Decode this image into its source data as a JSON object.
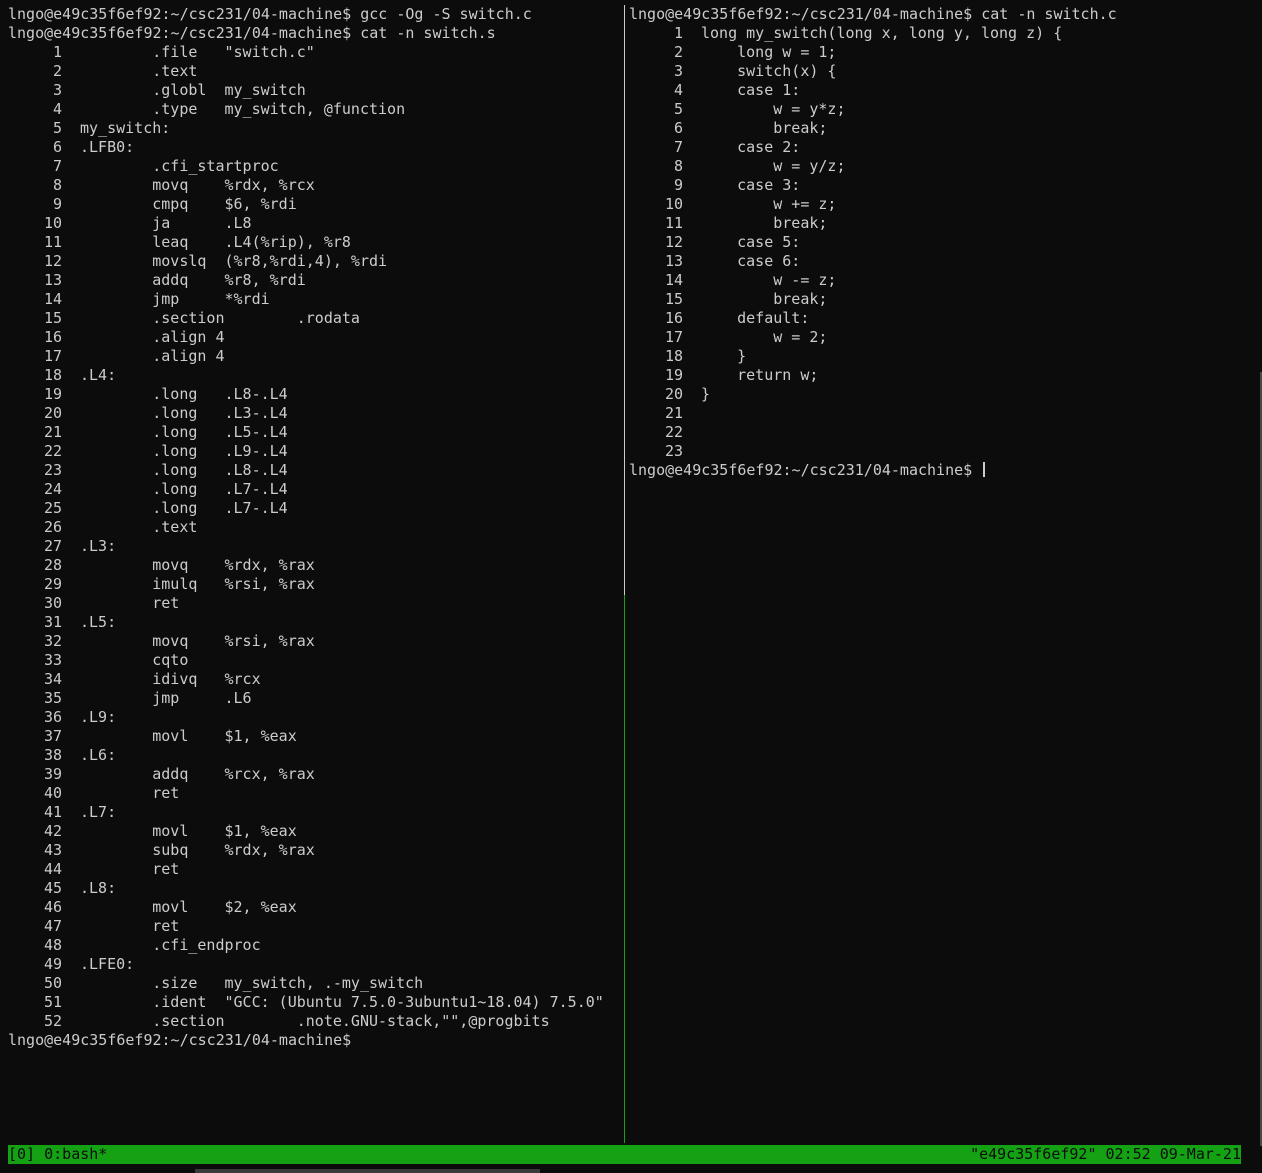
{
  "left_pane": {
    "commands": [
      "lngo@e49c35f6ef92:~/csc231/04-machine$ gcc -Og -S switch.c",
      "lngo@e49c35f6ef92:~/csc231/04-machine$ cat -n switch.s"
    ],
    "lines": [
      {
        "n": "1",
        "t": "        .file   \"switch.c\""
      },
      {
        "n": "2",
        "t": "        .text"
      },
      {
        "n": "3",
        "t": "        .globl  my_switch"
      },
      {
        "n": "4",
        "t": "        .type   my_switch, @function"
      },
      {
        "n": "5",
        "t": "my_switch:"
      },
      {
        "n": "6",
        "t": ".LFB0:"
      },
      {
        "n": "7",
        "t": "        .cfi_startproc"
      },
      {
        "n": "8",
        "t": "        movq    %rdx, %rcx"
      },
      {
        "n": "9",
        "t": "        cmpq    $6, %rdi"
      },
      {
        "n": "10",
        "t": "        ja      .L8"
      },
      {
        "n": "11",
        "t": "        leaq    .L4(%rip), %r8"
      },
      {
        "n": "12",
        "t": "        movslq  (%r8,%rdi,4), %rdi"
      },
      {
        "n": "13",
        "t": "        addq    %r8, %rdi"
      },
      {
        "n": "14",
        "t": "        jmp     *%rdi"
      },
      {
        "n": "15",
        "t": "        .section        .rodata"
      },
      {
        "n": "16",
        "t": "        .align 4"
      },
      {
        "n": "17",
        "t": "        .align 4"
      },
      {
        "n": "18",
        "t": ".L4:"
      },
      {
        "n": "19",
        "t": "        .long   .L8-.L4"
      },
      {
        "n": "20",
        "t": "        .long   .L3-.L4"
      },
      {
        "n": "21",
        "t": "        .long   .L5-.L4"
      },
      {
        "n": "22",
        "t": "        .long   .L9-.L4"
      },
      {
        "n": "23",
        "t": "        .long   .L8-.L4"
      },
      {
        "n": "24",
        "t": "        .long   .L7-.L4"
      },
      {
        "n": "25",
        "t": "        .long   .L7-.L4"
      },
      {
        "n": "26",
        "t": "        .text"
      },
      {
        "n": "27",
        "t": ".L3:"
      },
      {
        "n": "28",
        "t": "        movq    %rdx, %rax"
      },
      {
        "n": "29",
        "t": "        imulq   %rsi, %rax"
      },
      {
        "n": "30",
        "t": "        ret"
      },
      {
        "n": "31",
        "t": ".L5:"
      },
      {
        "n": "32",
        "t": "        movq    %rsi, %rax"
      },
      {
        "n": "33",
        "t": "        cqto"
      },
      {
        "n": "34",
        "t": "        idivq   %rcx"
      },
      {
        "n": "35",
        "t": "        jmp     .L6"
      },
      {
        "n": "36",
        "t": ".L9:"
      },
      {
        "n": "37",
        "t": "        movl    $1, %eax"
      },
      {
        "n": "38",
        "t": ".L6:"
      },
      {
        "n": "39",
        "t": "        addq    %rcx, %rax"
      },
      {
        "n": "40",
        "t": "        ret"
      },
      {
        "n": "41",
        "t": ".L7:"
      },
      {
        "n": "42",
        "t": "        movl    $1, %eax"
      },
      {
        "n": "43",
        "t": "        subq    %rdx, %rax"
      },
      {
        "n": "44",
        "t": "        ret"
      },
      {
        "n": "45",
        "t": ".L8:"
      },
      {
        "n": "46",
        "t": "        movl    $2, %eax"
      },
      {
        "n": "47",
        "t": "        ret"
      },
      {
        "n": "48",
        "t": "        .cfi_endproc"
      },
      {
        "n": "49",
        "t": ".LFE0:"
      },
      {
        "n": "50",
        "t": "        .size   my_switch, .-my_switch"
      },
      {
        "n": "51",
        "t": "        .ident  \"GCC: (Ubuntu 7.5.0-3ubuntu1~18.04) 7.5.0\""
      },
      {
        "n": "52",
        "t": "        .section        .note.GNU-stack,\"\",@progbits"
      }
    ],
    "prompt": "lngo@e49c35f6ef92:~/csc231/04-machine$"
  },
  "right_pane": {
    "command": "lngo@e49c35f6ef92:~/csc231/04-machine$ cat -n switch.c",
    "lines": [
      {
        "n": "1",
        "t": "long my_switch(long x, long y, long z) {"
      },
      {
        "n": "2",
        "t": "    long w = 1;"
      },
      {
        "n": "3",
        "t": "    switch(x) {"
      },
      {
        "n": "4",
        "t": "    case 1:"
      },
      {
        "n": "5",
        "t": "        w = y*z;"
      },
      {
        "n": "6",
        "t": "        break;"
      },
      {
        "n": "7",
        "t": "    case 2:"
      },
      {
        "n": "8",
        "t": "        w = y/z;"
      },
      {
        "n": "9",
        "t": "    case 3:"
      },
      {
        "n": "10",
        "t": "        w += z;"
      },
      {
        "n": "11",
        "t": "        break;"
      },
      {
        "n": "12",
        "t": "    case 5:"
      },
      {
        "n": "13",
        "t": "    case 6:"
      },
      {
        "n": "14",
        "t": "        w -= z;"
      },
      {
        "n": "15",
        "t": "        break;"
      },
      {
        "n": "16",
        "t": "    default:"
      },
      {
        "n": "17",
        "t": "        w = 2;"
      },
      {
        "n": "18",
        "t": "    }"
      },
      {
        "n": "19",
        "t": "    return w;"
      },
      {
        "n": "20",
        "t": "}"
      },
      {
        "n": "21",
        "t": ""
      },
      {
        "n": "22",
        "t": ""
      },
      {
        "n": "23",
        "t": ""
      }
    ],
    "prompt": "lngo@e49c35f6ef92:~/csc231/04-machine$"
  },
  "status_bar": {
    "left": "[0] 0:bash*",
    "right": "\"e49c35f6ef92\" 02:52 09-Mar-21"
  }
}
